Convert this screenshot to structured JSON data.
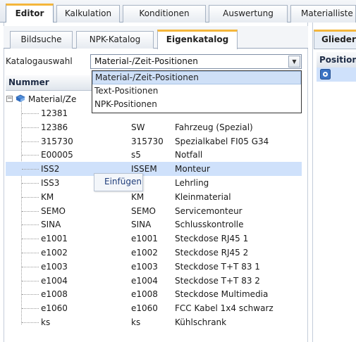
{
  "top_tabs": [
    "Editor",
    "Kalkulation",
    "Konditionen",
    "Auswertung",
    "Materialliste"
  ],
  "sub_tabs": [
    "Bildsuche",
    "NPK-Katalog",
    "Eigenkatalog"
  ],
  "catalog": {
    "label": "Katalogauswahl",
    "selected": "Material-/Zeit-Positionen",
    "options": [
      "Material-/Zeit-Positionen",
      "Text-Positionen",
      "NPK-Positionen"
    ]
  },
  "tree": {
    "column_header": "Nummer",
    "root_label": "Material/Ze",
    "rows": [
      {
        "num": "12381",
        "code": "",
        "desc": ""
      },
      {
        "num": "12386",
        "code": "SW",
        "desc": "Fahrzeug (Spezial)"
      },
      {
        "num": "315730",
        "code": "315730",
        "desc": "Spezialkabel FI05 G34"
      },
      {
        "num": "E00005",
        "code": "s5",
        "desc": "Notfall"
      },
      {
        "num": "ISS2",
        "code": "ISSEM",
        "desc": "Monteur"
      },
      {
        "num": "ISS3",
        "code": "",
        "desc": "Lehrling"
      },
      {
        "num": "KM",
        "code": "KM",
        "desc": "Kleinmaterial"
      },
      {
        "num": "SEMO",
        "code": "SEMO",
        "desc": "Servicemonteur"
      },
      {
        "num": "SINA",
        "code": "SINA",
        "desc": "Schlusskontrolle"
      },
      {
        "num": "e1001",
        "code": "e1001",
        "desc": "Steckdose RJ45 1"
      },
      {
        "num": "e1002",
        "code": "e1002",
        "desc": "Steckdose RJ45 2"
      },
      {
        "num": "e1003",
        "code": "e1003",
        "desc": "Steckdose T+T 83 1"
      },
      {
        "num": "e1004",
        "code": "e1004",
        "desc": "Steckdose T+T 83 2"
      },
      {
        "num": "e1008",
        "code": "e1008",
        "desc": "Steckdose Multimedia"
      },
      {
        "num": "e1060",
        "code": "e1060",
        "desc": "FCC Kabel 1x4 schwarz"
      },
      {
        "num": "ks",
        "code": "ks",
        "desc": "Kühlschrank"
      }
    ]
  },
  "context_menu": {
    "item": "Einfügen"
  },
  "right_panel": {
    "tab": "Glieder",
    "header": "Position"
  },
  "colors": {
    "active_tab_accent": "#f4b63b",
    "selection": "#cfe1fb"
  }
}
